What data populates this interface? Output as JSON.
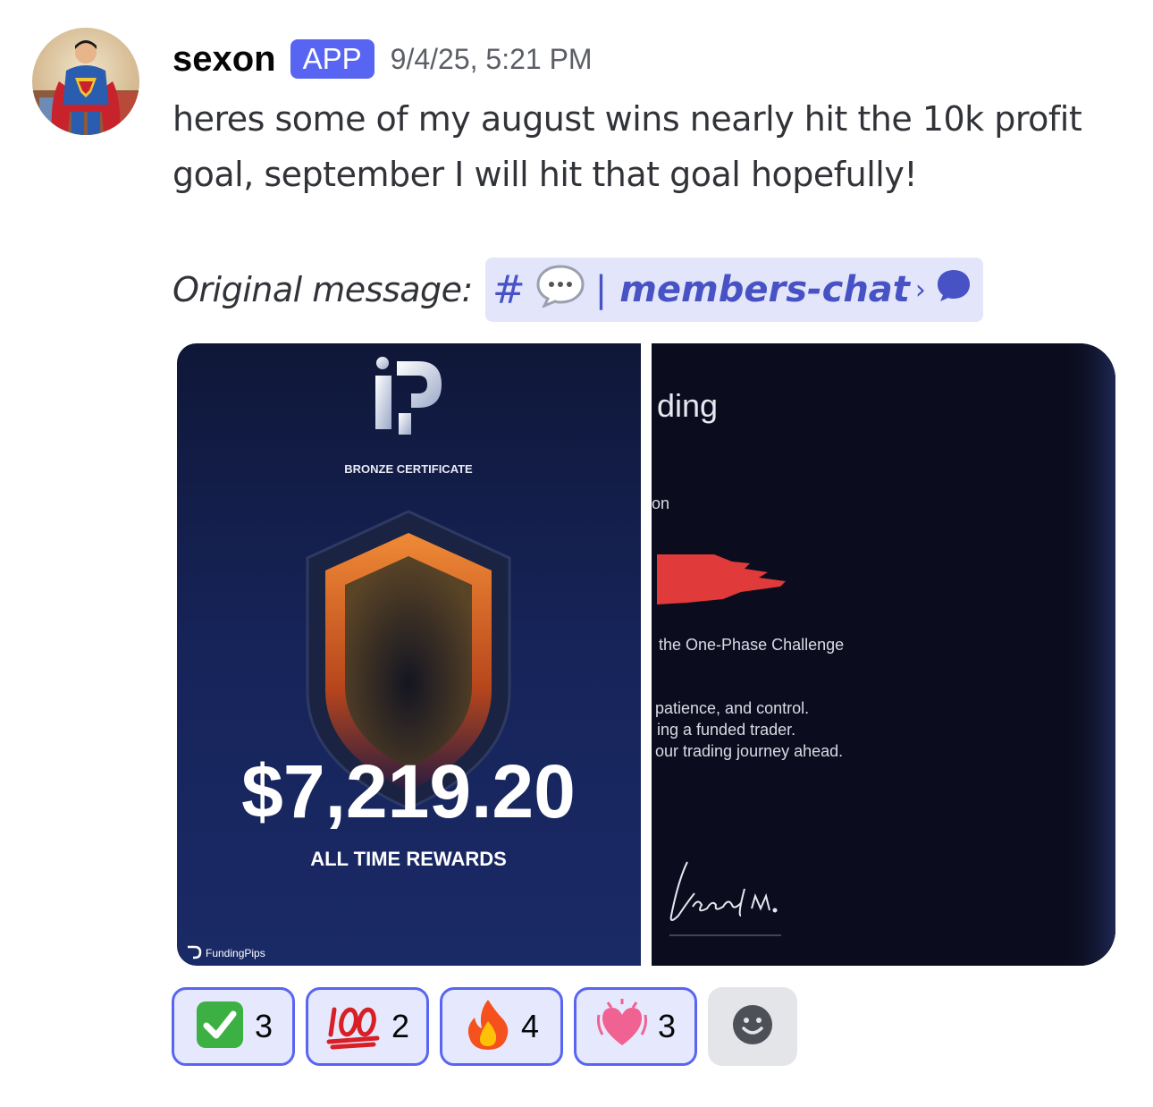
{
  "message": {
    "username": "sexon",
    "badge": "APP",
    "timestamp": "9/4/25, 5:21 PM",
    "text": "heres some of my august wins nearly hit the 10k profit goal, september I will hit that goal hopefully!",
    "original_label": "Original message:",
    "channel": {
      "hash": "#",
      "separator": "|",
      "name": "members-chat",
      "chevron": "›"
    }
  },
  "certificate": {
    "tier": "BRONZE CERTIFICATE",
    "amount": "$7,219.20",
    "caption": "ALL TIME REWARDS",
    "brand": "FundingPips"
  },
  "letter": {
    "title_fragment": "ding",
    "line1": "on",
    "line2": "the One-Phase Challenge",
    "line3": "patience, and control.",
    "line4": "ing a funded trader.",
    "line5": "our trading journey ahead.",
    "signature": "Lewis M."
  },
  "reactions": [
    {
      "emoji": "check-mark-emoji",
      "count": "3"
    },
    {
      "emoji": "hundred-points-emoji",
      "count": "2"
    },
    {
      "emoji": "fire-emoji",
      "count": "4"
    },
    {
      "emoji": "growing-heart-emoji",
      "count": "3"
    }
  ],
  "colors": {
    "accent": "#5865f2",
    "mention_bg": "#e3e5fb",
    "mention_text": "#4752c4",
    "reaction_bg": "#e6e8fd",
    "cert_bg": "#16204a",
    "bronze": "#e8742b",
    "redaction": "#e03a3a"
  }
}
